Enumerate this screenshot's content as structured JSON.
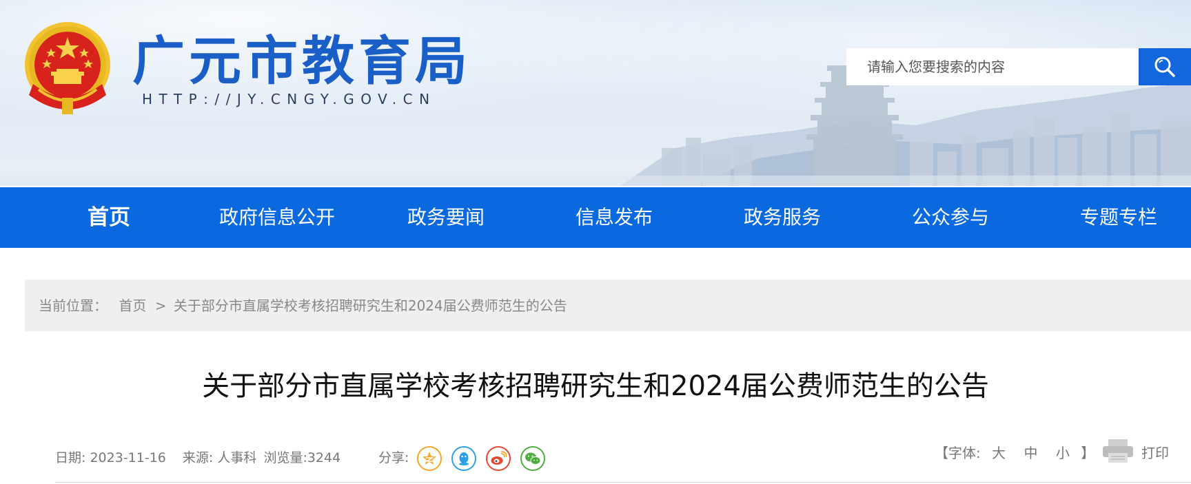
{
  "header": {
    "site_title": "广元市教育局",
    "site_url": "HTTP://JY.CNGY.GOV.CN",
    "search_placeholder": "请输入您要搜索的内容"
  },
  "nav": {
    "items": [
      {
        "label": "首页",
        "active": true
      },
      {
        "label": "政府信息公开"
      },
      {
        "label": "政务要闻"
      },
      {
        "label": "信息发布"
      },
      {
        "label": "政务服务"
      },
      {
        "label": "公众参与"
      },
      {
        "label": "专题专栏"
      }
    ]
  },
  "breadcrumb": {
    "prefix": "当前位置：",
    "home": "首页",
    "separator": ">",
    "current": "关于部分市直属学校考核招聘研究生和2024届公费师范生的公告"
  },
  "article": {
    "title": "关于部分市直属学校考核招聘研究生和2024届公费师范生的公告",
    "date_label": "日期:",
    "date": "2023-11-16",
    "source_label": "来源:",
    "source": "人事科",
    "views_label": "浏览量:",
    "views": "3244"
  },
  "share": {
    "label": "分享:",
    "icons": [
      "qzone-icon",
      "qq-icon",
      "weibo-icon",
      "wechat-icon"
    ]
  },
  "font_size": {
    "open": "【字体:",
    "large": "大",
    "medium": "中",
    "small": "小",
    "close": "】"
  },
  "print": {
    "label": "打印"
  },
  "colors": {
    "nav_bg": "#0a69df",
    "title_blue": "#1a5fc7",
    "search_btn": "#1366dd",
    "qzone": "#f5a623",
    "qq": "#2b9fe8",
    "weibo": "#e6452e",
    "wechat": "#4cae3c"
  }
}
